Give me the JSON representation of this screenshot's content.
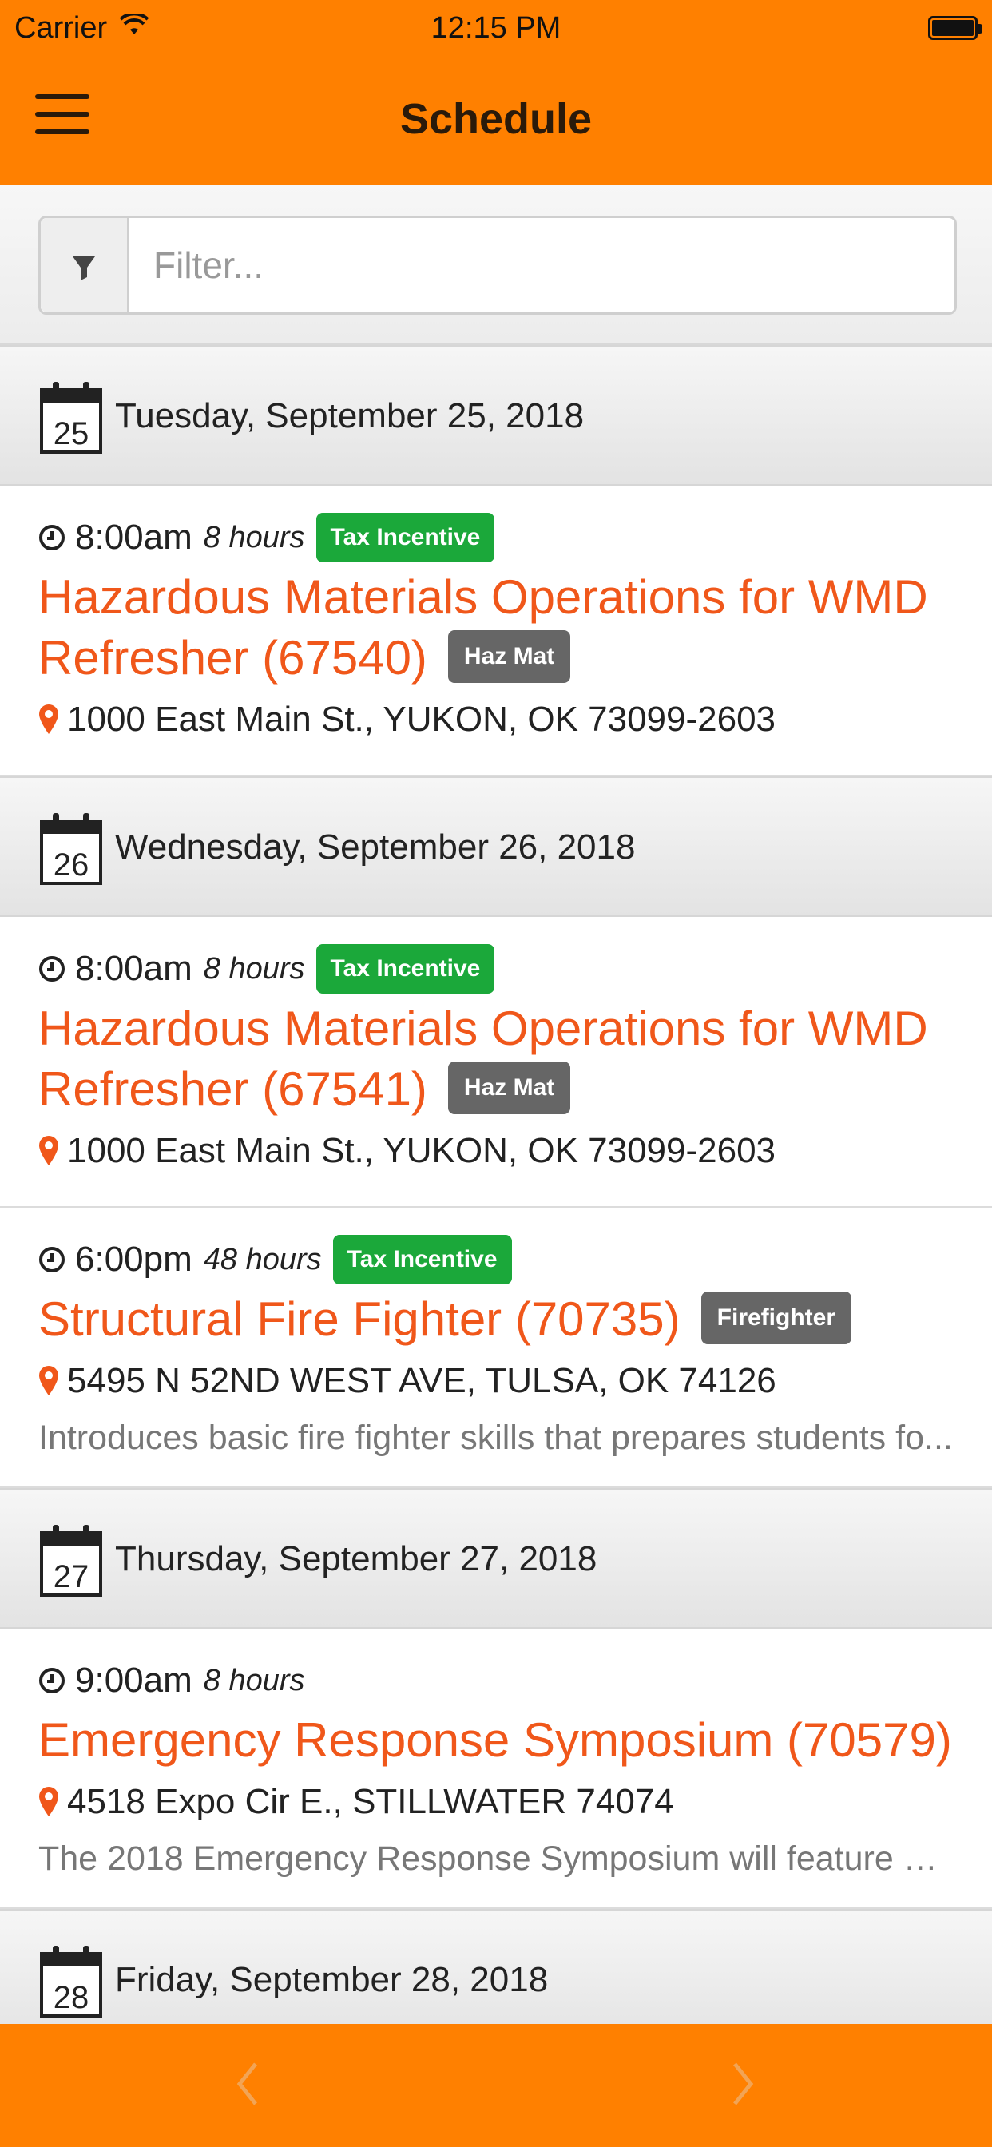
{
  "status_bar": {
    "carrier": "Carrier",
    "time": "12:15 PM",
    "icons": [
      "wifi-icon",
      "battery-icon"
    ]
  },
  "nav": {
    "title": "Schedule",
    "menu_icon": "hamburger-icon"
  },
  "filter": {
    "placeholder": "Filter...",
    "icon": "filter-icon"
  },
  "days": [
    {
      "day_number": "25",
      "label": "Tuesday, September 25, 2018",
      "events": [
        {
          "time": "8:00am",
          "duration": "8 hours",
          "tag": "Tax Incentive",
          "title": "Hazardous Materials Operations for WMD Refresher (67540)",
          "category": "Haz Mat",
          "address": "1000 East Main St., YUKON, OK 73099-2603",
          "description": ""
        }
      ]
    },
    {
      "day_number": "26",
      "label": "Wednesday, September 26, 2018",
      "events": [
        {
          "time": "8:00am",
          "duration": "8 hours",
          "tag": "Tax Incentive",
          "title": "Hazardous Materials Operations for WMD Refresher (67541)",
          "category": "Haz Mat",
          "address": "1000 East Main St., YUKON, OK 73099-2603",
          "description": ""
        },
        {
          "time": "6:00pm",
          "duration": "48 hours",
          "tag": "Tax Incentive",
          "title": "Structural Fire Fighter (70735)",
          "category": "Firefighter",
          "address": "5495 N 52ND WEST AVE, TULSA, OK 74126",
          "description": "Introduces basic fire fighter skills that prepares students fo..."
        }
      ]
    },
    {
      "day_number": "27",
      "label": "Thursday, September 27, 2018",
      "events": [
        {
          "time": "9:00am",
          "duration": "8 hours",
          "tag": "",
          "title": "Emergency Response Symposium (70579)",
          "category": "",
          "address": "4518 Expo Cir E., STILLWATER 74074",
          "description": "The 2018 Emergency Response Symposium will feature m..."
        }
      ]
    },
    {
      "day_number": "28",
      "label": "Friday, September 28, 2018",
      "events": []
    }
  ],
  "toolbar": {
    "back_icon": "chevron-left-icon",
    "forward_icon": "chevron-right-icon"
  },
  "colors": {
    "accent": "#ff8000",
    "title": "#f0571a",
    "tag_green": "#1ba83a",
    "category_gray": "#666666"
  }
}
